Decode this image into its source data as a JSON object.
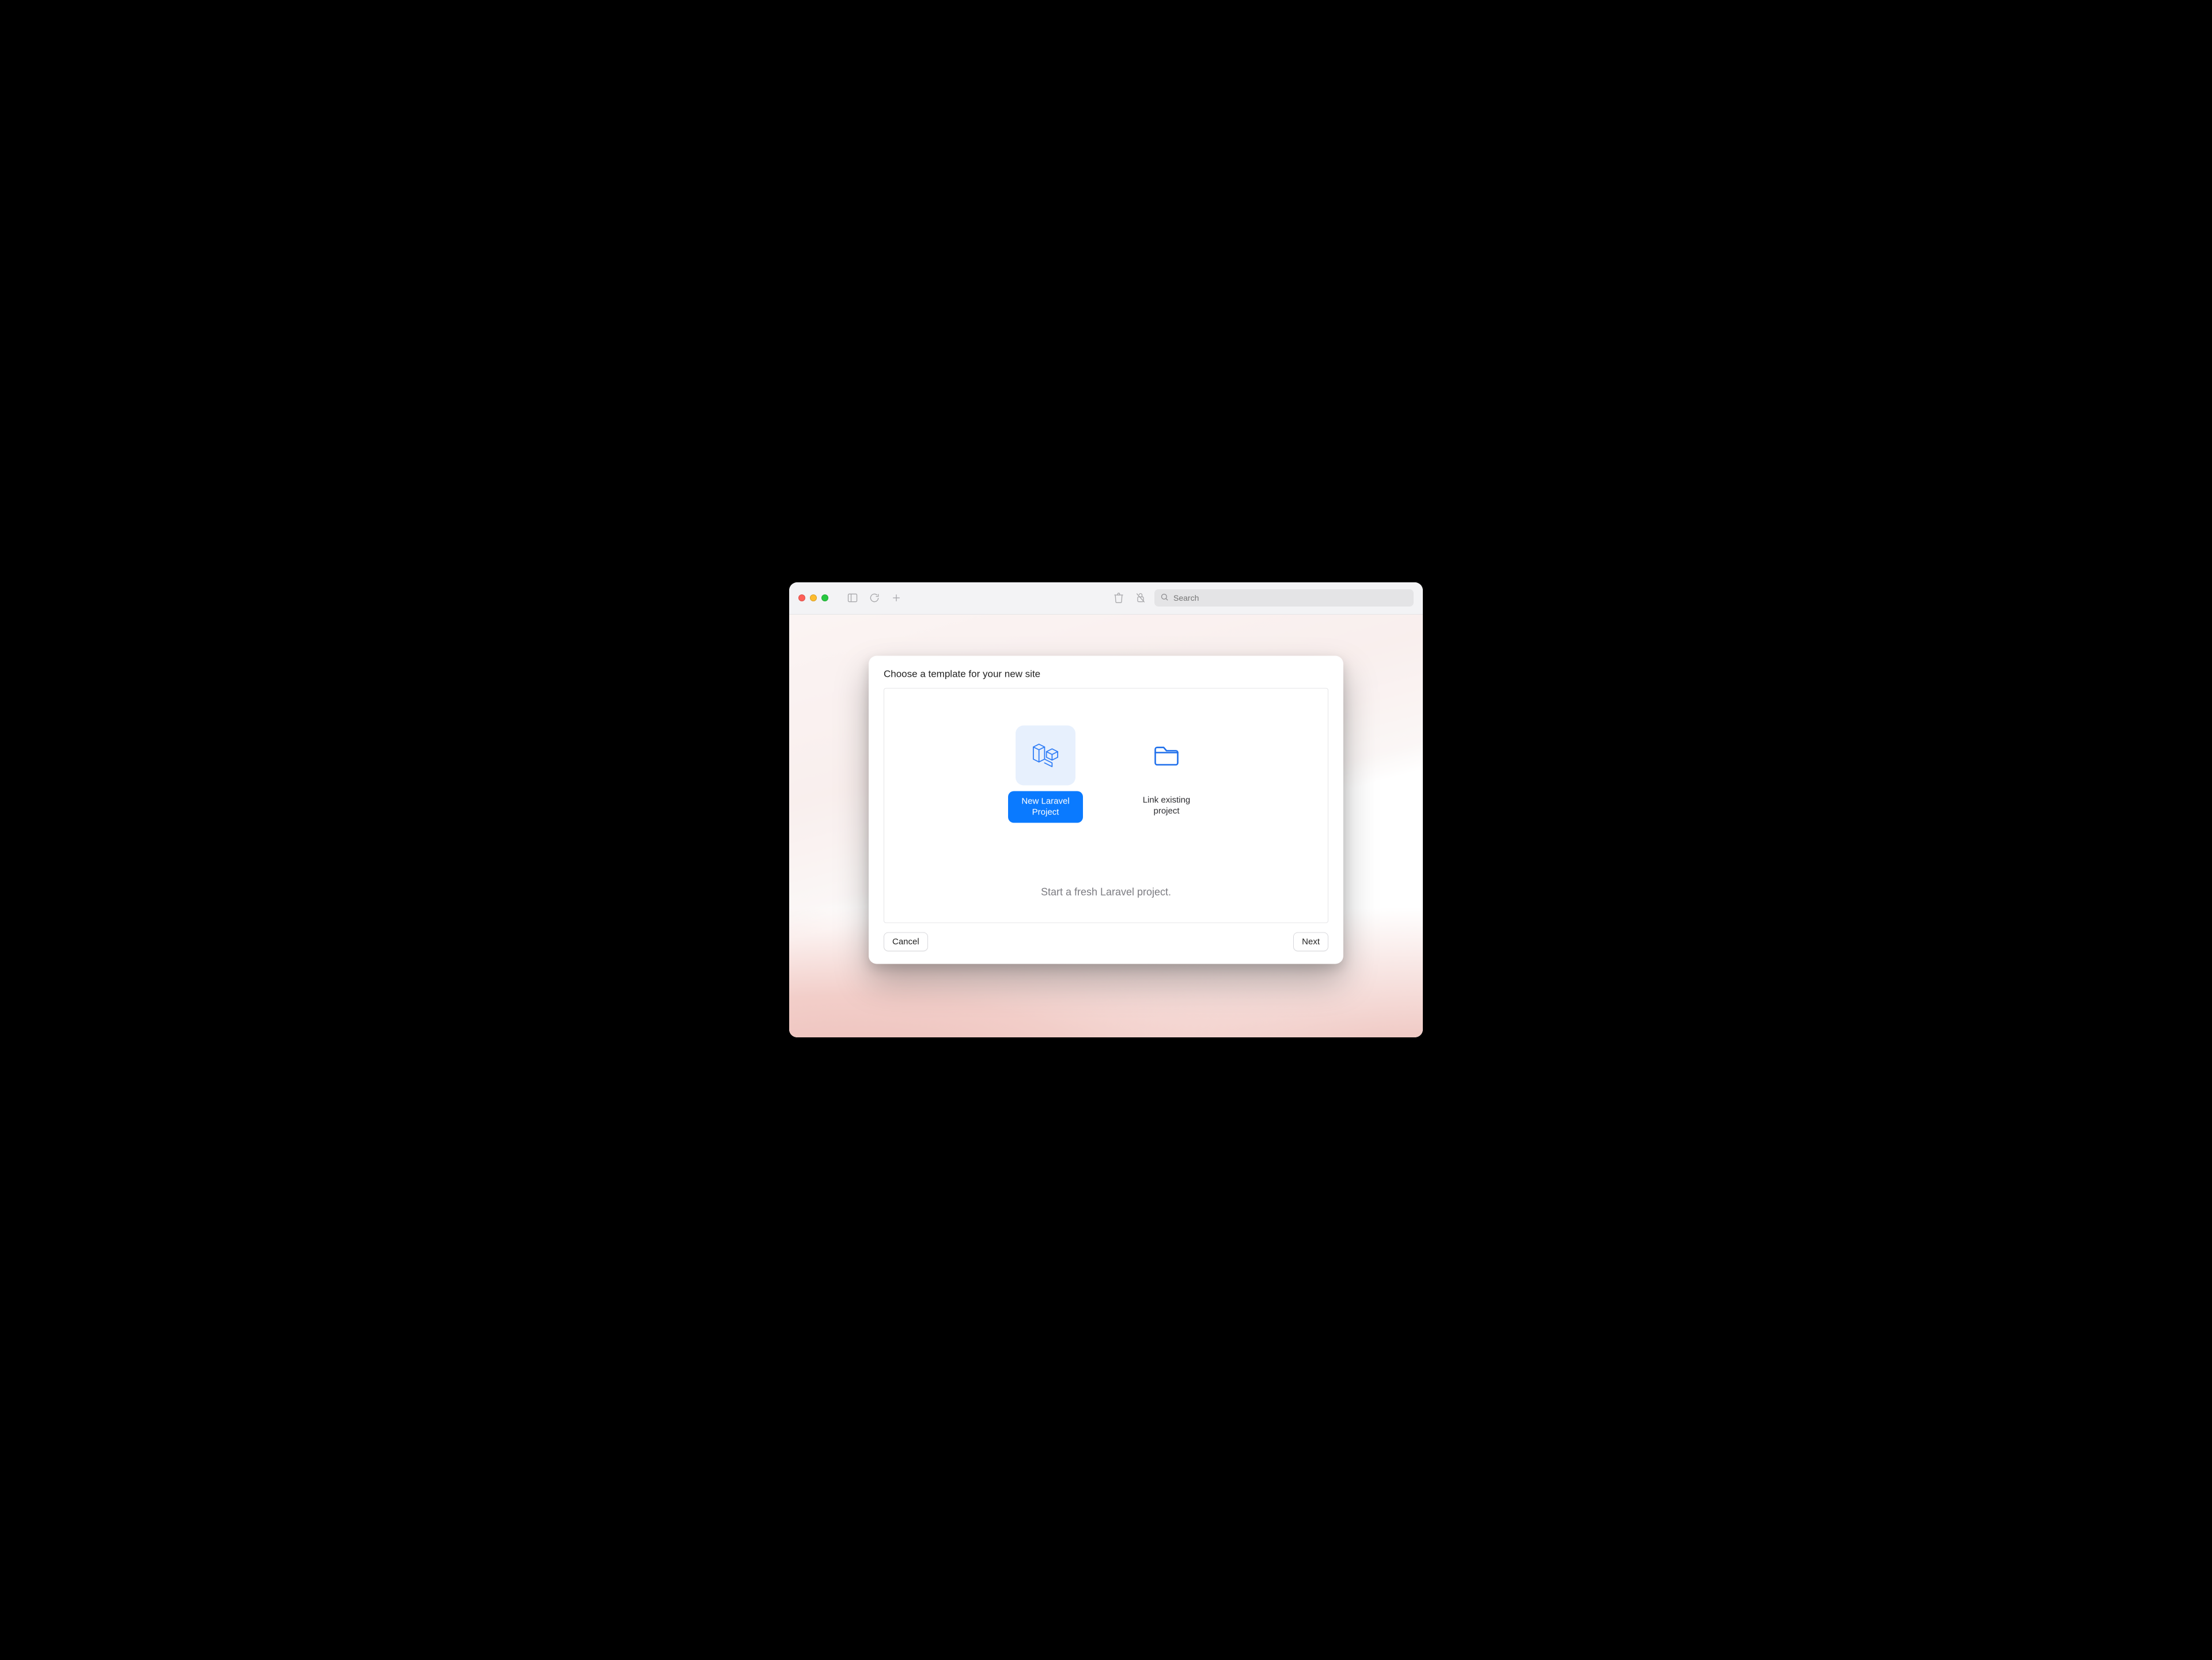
{
  "toolbar": {
    "search_placeholder": "Search"
  },
  "modal": {
    "title": "Choose a template for your new site",
    "options": [
      {
        "id": "new-laravel",
        "label": "New Laravel Project",
        "selected": true
      },
      {
        "id": "link-existing",
        "label": "Link existing project",
        "selected": false
      }
    ],
    "hint": "Start a fresh Laravel project.",
    "cancel_label": "Cancel",
    "next_label": "Next"
  },
  "icons": {
    "sidebar": "sidebar-icon",
    "refresh": "refresh-icon",
    "add": "plus-icon",
    "trash": "trash-icon",
    "unlink": "unlink-icon",
    "search": "search-icon",
    "laravel": "laravel-icon",
    "folder": "folder-icon"
  },
  "colors": {
    "accent": "#0a7aff",
    "icon_blue": "#1f6feb",
    "window_bg": "#f5f5f7"
  }
}
